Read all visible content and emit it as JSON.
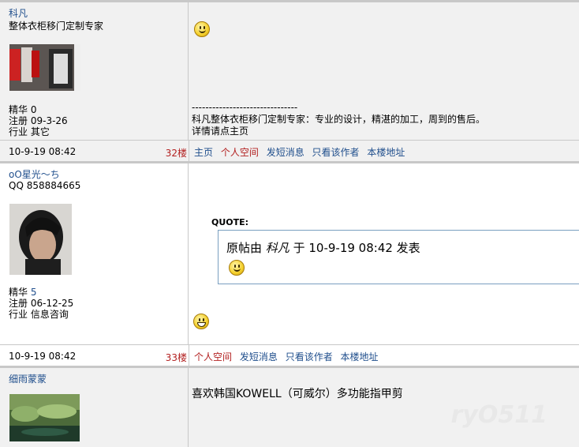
{
  "posts": [
    {
      "user": "科凡",
      "subtitle": "整体衣柜移门定制专家",
      "stats": {
        "jinghua_label": "精华",
        "jinghua": "0",
        "reg_label": "注册",
        "reg": "09-3-26",
        "ind_label": "行业",
        "ind": "其它"
      },
      "signature_rule": "-------------------------------",
      "signature_line1": "科凡整体衣柜移门定制专家：专业的设计，精湛的加工，周到的售后。",
      "signature_line2": "详情请点主页",
      "date": "10-9-19 08:42",
      "floor": "32楼",
      "links": [
        "主页",
        "个人空间",
        "发短消息",
        "只看该作者",
        "本楼地址"
      ]
    },
    {
      "user": "oO星光〜ち",
      "subtitle": "QQ 858884665",
      "stats": {
        "jinghua_label": "精华",
        "jinghua": "5",
        "reg_label": "注册",
        "reg": "06-12-25",
        "ind_label": "行业",
        "ind": "信息咨询"
      },
      "quote_label": "QUOTE:",
      "quote_prefix": "原帖由",
      "quote_author": "科凡",
      "quote_suffix": "于 10-9-19 08:42 发表",
      "date": "10-9-19 08:42",
      "floor": "33楼",
      "links": [
        "个人空间",
        "发短消息",
        "只看该作者",
        "本楼地址"
      ]
    },
    {
      "user": "细雨蒙蒙",
      "content": "喜欢韩国KOWELL（可威尔）多功能指甲剪"
    }
  ],
  "watermark": "ryO511"
}
